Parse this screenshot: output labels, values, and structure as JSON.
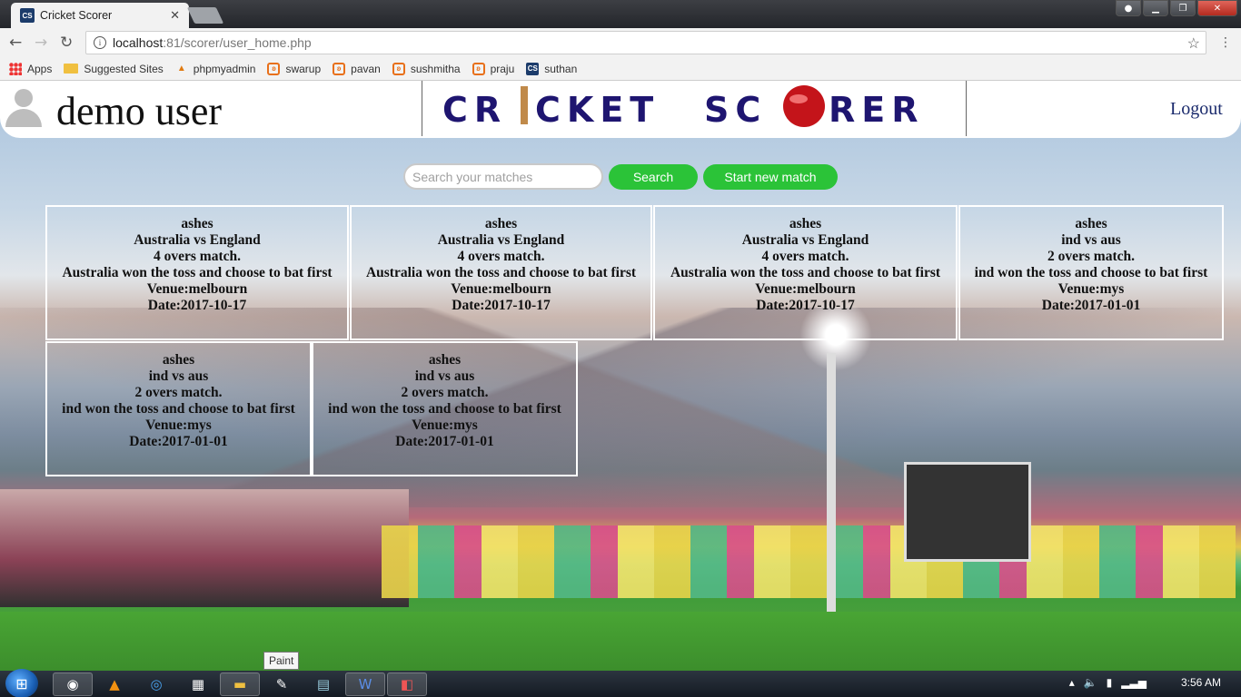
{
  "browser": {
    "tab_title": "Cricket Scorer",
    "tab_favicon": "CS",
    "url_host": "localhost",
    "url_path": ":81/scorer/user_home.php",
    "bookmarks": [
      {
        "label": "Apps",
        "icon": "apps-grid-icon"
      },
      {
        "label": "Suggested Sites",
        "icon": "folder-icon"
      },
      {
        "label": "phpmyadmin",
        "icon": "phpmyadmin-icon"
      },
      {
        "label": "swarup",
        "icon": "xampp-icon"
      },
      {
        "label": "pavan",
        "icon": "xampp-icon"
      },
      {
        "label": "sushmitha",
        "icon": "xampp-icon"
      },
      {
        "label": "praju",
        "icon": "xampp-icon"
      },
      {
        "label": "suthan",
        "icon": "cs-icon"
      }
    ]
  },
  "header": {
    "username": "demo user",
    "logo_text": "CRICKET SCORER",
    "logout_label": "Logout"
  },
  "search": {
    "placeholder": "Search your matches",
    "search_label": "Search",
    "new_match_label": "Start new match"
  },
  "matches": [
    {
      "series": "ashes",
      "teams": "Australia vs England",
      "overs": "4 overs match.",
      "toss": "Australia won the toss and choose to bat first",
      "venue": "Venue:melbourn",
      "date": "Date:2017-10-17"
    },
    {
      "series": "ashes",
      "teams": "Australia vs England",
      "overs": "4 overs match.",
      "toss": "Australia won the toss and choose to bat first",
      "venue": "Venue:melbourn",
      "date": "Date:2017-10-17"
    },
    {
      "series": "ashes",
      "teams": "Australia vs England",
      "overs": "4 overs match.",
      "toss": "Australia won the toss and choose to bat first",
      "venue": "Venue:melbourn",
      "date": "Date:2017-10-17"
    },
    {
      "series": "ashes",
      "teams": "ind vs aus",
      "overs": "2 overs match.",
      "toss": "ind won the toss and choose to bat first",
      "venue": "Venue:mys",
      "date": "Date:2017-01-01"
    },
    {
      "series": "ashes",
      "teams": "ind vs aus",
      "overs": "2 overs match.",
      "toss": "ind won the toss and choose to bat first",
      "venue": "Venue:mys",
      "date": "Date:2017-01-01"
    },
    {
      "series": "ashes",
      "teams": "ind vs aus",
      "overs": "2 overs match.",
      "toss": "ind won the toss and choose to bat first",
      "venue": "Venue:mys",
      "date": "Date:2017-01-01"
    }
  ],
  "taskbar": {
    "tooltip": "Paint",
    "clock": "3:56 AM",
    "apps": [
      "chrome-icon",
      "vlc-icon",
      "browser-icon",
      "control-panel-icon",
      "explorer-icon",
      "paint-icon",
      "notepad-icon",
      "word-icon",
      "presentation-icon"
    ]
  },
  "colors": {
    "accent_green": "#2bc338",
    "logo_navy": "#1e1570",
    "logout_blue": "#1a2a6c"
  }
}
